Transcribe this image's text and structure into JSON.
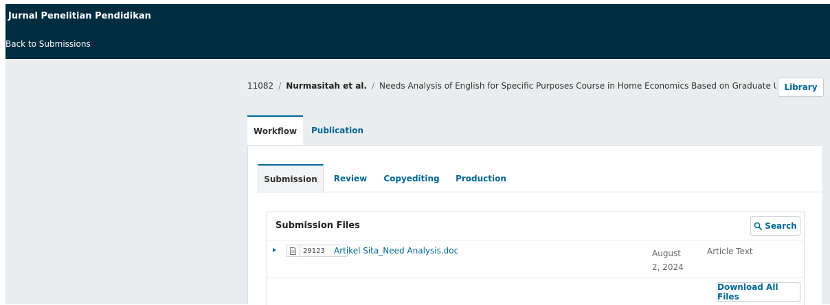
{
  "header": {
    "journal_title": "Jurnal Penelitian Pendidikan",
    "back_link": "Back to Submissions"
  },
  "breadcrumb": {
    "id": "11082",
    "author": "Nurmasitah et al.",
    "title": "Needs Analysis of English for Specific Purposes Course in Home Economics Based on Graduate Users' Perception"
  },
  "library_button": "Library",
  "main_tabs": [
    {
      "label": "Workflow",
      "active": true
    },
    {
      "label": "Publication",
      "active": false
    }
  ],
  "sub_tabs": [
    {
      "label": "Submission",
      "active": true
    },
    {
      "label": "Review",
      "active": false
    },
    {
      "label": "Copyediting",
      "active": false
    },
    {
      "label": "Production",
      "active": false
    }
  ],
  "submission_files": {
    "title": "Submission Files",
    "search_label": "Search",
    "files": [
      {
        "id": "29123",
        "name": "Artikel Sita_Need Analysis.doc",
        "date": "August 2, 2024",
        "type": "Article Text"
      }
    ],
    "download_all_label": "Download All Files"
  },
  "colors": {
    "header_bg": "#002c40",
    "link": "#006798",
    "page_bg": "#eaedee"
  }
}
